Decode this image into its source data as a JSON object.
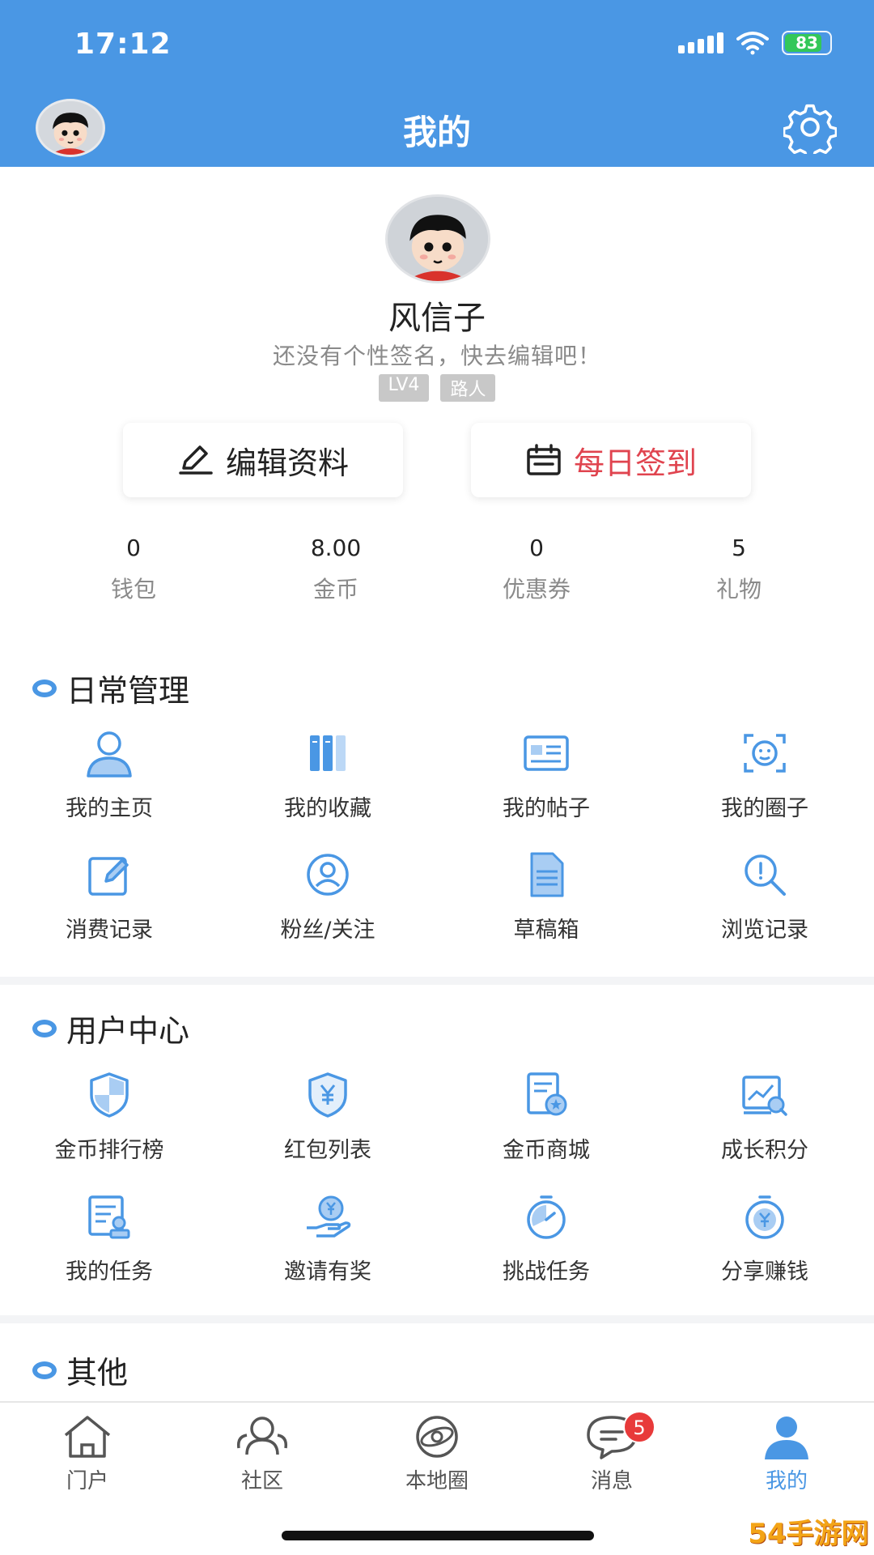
{
  "status_bar": {
    "time": "17:12",
    "battery": "83",
    "battery_level": 0.83,
    "battery_color": "#33c759"
  },
  "header": {
    "title": "我的",
    "background": "#4a97e4",
    "avatar_icon": "cartoon-avatar-icon",
    "settings_icon": "gear-icon"
  },
  "profile": {
    "name": "风信子",
    "signature": "还没有个性签名，快去编辑吧！",
    "tags": [
      "LV4",
      "路人"
    ]
  },
  "actions": {
    "edit_label": "编辑资料",
    "edit_icon": "pencil-icon",
    "sign_label": "每日签到",
    "sign_icon": "calendar-icon",
    "sign_color": "#e0444f"
  },
  "stats": [
    {
      "value": "0",
      "label": "钱包"
    },
    {
      "value": "8.00",
      "label": "金币"
    },
    {
      "value": "0",
      "label": "优惠券"
    },
    {
      "value": "5",
      "label": "礼物"
    }
  ],
  "sections": {
    "daily": {
      "title": "日常管理",
      "items": [
        {
          "label": "我的主页",
          "icon": "user-icon"
        },
        {
          "label": "我的收藏",
          "icon": "books-icon"
        },
        {
          "label": "我的帖子",
          "icon": "id-card-icon"
        },
        {
          "label": "我的圈子",
          "icon": "face-scan-icon"
        },
        {
          "label": "消费记录",
          "icon": "edit-note-icon"
        },
        {
          "label": "粉丝/关注",
          "icon": "user-search-icon"
        },
        {
          "label": "草稿箱",
          "icon": "document-icon"
        },
        {
          "label": "浏览记录",
          "icon": "magnifier-icon"
        }
      ]
    },
    "user_center": {
      "title": "用户中心",
      "items": [
        {
          "label": "金币排行榜",
          "icon": "shield-icon"
        },
        {
          "label": "红包列表",
          "icon": "yuan-shield-icon"
        },
        {
          "label": "金币商城",
          "icon": "store-list-icon"
        },
        {
          "label": "成长积分",
          "icon": "growth-chart-icon"
        },
        {
          "label": "我的任务",
          "icon": "task-list-icon"
        },
        {
          "label": "邀请有奖",
          "icon": "hand-coin-icon"
        },
        {
          "label": "挑战任务",
          "icon": "stopwatch-icon"
        },
        {
          "label": "分享赚钱",
          "icon": "coin-timer-icon"
        }
      ]
    },
    "other": {
      "title": "其他"
    }
  },
  "tabbar": {
    "items": [
      {
        "label": "门户",
        "icon": "house-icon"
      },
      {
        "label": "社区",
        "icon": "community-icon"
      },
      {
        "label": "本地圈",
        "icon": "planet-icon"
      },
      {
        "label": "消息",
        "icon": "chat-icon",
        "badge": "5"
      },
      {
        "label": "我的",
        "icon": "user-icon"
      }
    ],
    "active_color": "#4a97e4",
    "badge_color": "#e83a3a"
  },
  "watermark": "54手游网"
}
